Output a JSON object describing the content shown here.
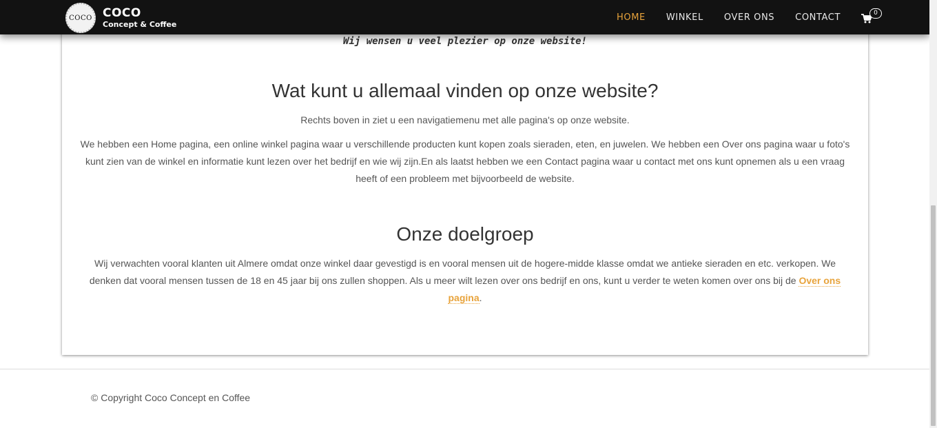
{
  "brand": {
    "logo_text": "COCO",
    "title": "COCO",
    "subtitle": "Concept & Coffee"
  },
  "nav": {
    "items": [
      {
        "label": "HOME",
        "active": true
      },
      {
        "label": "WINKEL",
        "active": false
      },
      {
        "label": "OVER ONS",
        "active": false
      },
      {
        "label": "CONTACT",
        "active": false
      }
    ],
    "cart_count": "0",
    "cart_icon": "shopping-cart-icon"
  },
  "content": {
    "welcome": "Wij wensen u veel plezier op onze website!",
    "section1": {
      "title": "Wat kunt u allemaal vinden op onze website?",
      "para1": "Rechts boven in ziet u een navigatiemenu met alle pagina's op onze website.",
      "para2": "We hebben een Home pagina, een online winkel pagina waar u verschillende producten kunt kopen zoals sieraden, eten, en juwelen. We hebben een Over ons pagina waar u foto's kunt zien van de winkel en informatie kunt lezen over het bedrijf en wie wij zijn.En als laatst hebben we een Contact pagina waar u contact met ons kunt opnemen als u een vraag heeft of een probleem met bijvoorbeeld de website."
    },
    "section2": {
      "title": "Onze doelgroep",
      "para": "Wij verwachten vooral klanten uit Almere omdat onze winkel daar gevestigd is en vooral mensen uit de hogere-midde klasse omdat we antieke sieraden en etc. verkopen. We denken dat vooral mensen tussen de 18 en 45 jaar bij ons zullen shoppen. Als u meer wilt lezen over ons bedrijf en ons, kunt u verder te weten komen over ons bij de ",
      "link_label": "Over ons pagina",
      "para_end": "."
    }
  },
  "footer": {
    "copyright": "© Copyright Coco Concept en Coffee"
  },
  "colors": {
    "navbar_bg": "#121212",
    "accent": "#e8a33b",
    "text": "#555555",
    "heading": "#333333"
  }
}
